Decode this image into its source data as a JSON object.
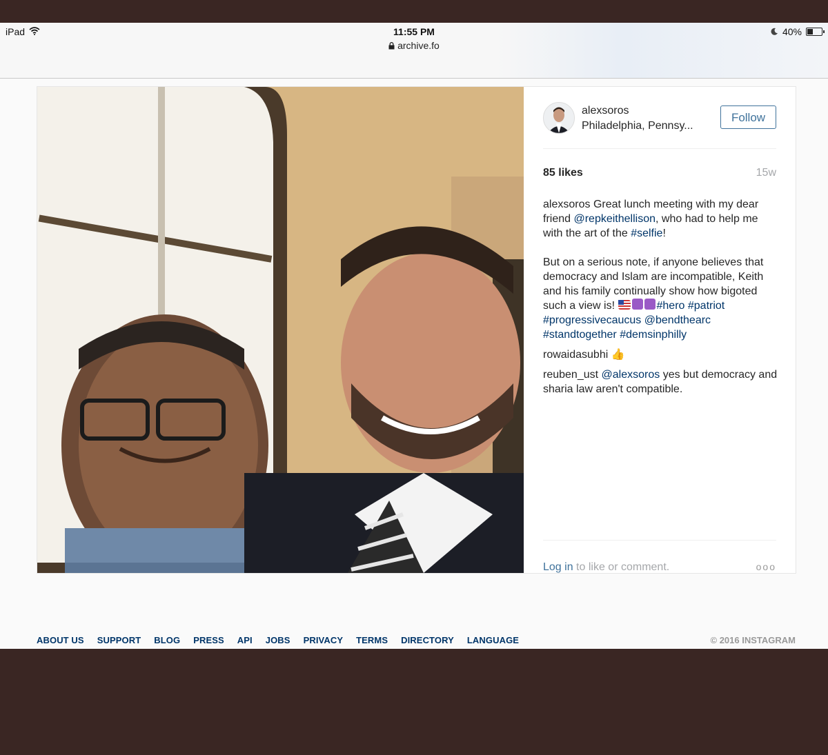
{
  "status_bar": {
    "device": "iPad",
    "time": "11:55 PM",
    "url": "archive.fo",
    "battery": "40%",
    "battery_level": 0.4
  },
  "post": {
    "username": "alexsoros",
    "location": "Philadelphia, Pennsy...",
    "follow_label": "Follow",
    "likes": "85 likes",
    "age": "15w",
    "caption": {
      "user": "alexsoros",
      "t1": "Great lunch meeting with my dear friend",
      "mention1": "@repkeithellison",
      "t2": ", who had to help me with the art of the",
      "tag_selfie": "#selfie",
      "t3": "!",
      "t4": "But on a serious note, if anyone believes that democracy and Islam are incompatible, Keith and his family continually show how bigoted such a view is!",
      "tag_hero": "#hero",
      "tag_patriot": "#patriot",
      "tag_progressive": "#progressivecaucus",
      "mention_bend": "@bendthearc",
      "tag_standtogether": "#standtogether",
      "tag_dems": "#demsinphilly"
    },
    "comments": [
      {
        "user": "rowaidasubhi",
        "text": "👍"
      },
      {
        "user": "reuben_ust",
        "mention": "@alexsoros",
        "text": "yes but democracy and sharia law aren't compatible."
      }
    ],
    "login_link": "Log in",
    "login_rest": "to like or comment.",
    "more": "ooo"
  },
  "footer": {
    "links": [
      "ABOUT US",
      "SUPPORT",
      "BLOG",
      "PRESS",
      "API",
      "JOBS",
      "PRIVACY",
      "TERMS",
      "DIRECTORY",
      "LANGUAGE"
    ],
    "copyright": "© 2016 INSTAGRAM"
  },
  "colors": {
    "link_blue": "#003569",
    "follow_blue": "#3f729b",
    "muted": "#a5a7aa",
    "outer_bg": "#3a2623"
  },
  "icons": [
    "wifi-icon",
    "lock-icon",
    "moon-icon",
    "battery-icon",
    "more-options-icon"
  ]
}
